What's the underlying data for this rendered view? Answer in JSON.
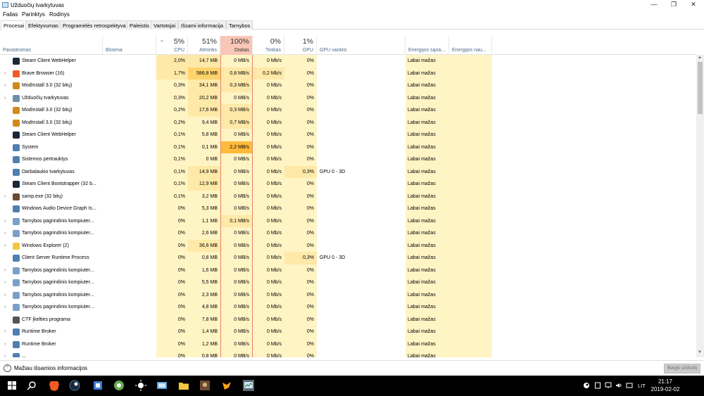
{
  "window": {
    "title": "Užduočių tvarkytuvas",
    "minimize": "—",
    "maximize": "❐",
    "close": "✕"
  },
  "menu": [
    "Failas",
    "Parinktys",
    "Rodinys"
  ],
  "tabs": [
    "Procesai",
    "Efektyvumas",
    "Programėlės retrospektyva",
    "Paleistis",
    "Vartotojai",
    "Išsami informacija",
    "Tarnybos"
  ],
  "active_tab": "Procesai",
  "columns": {
    "name": "Pavadinimas",
    "status": "Būsena",
    "cpu": {
      "pct": "5%",
      "label": "CPU"
    },
    "mem": {
      "pct": "51%",
      "label": "Atmintis"
    },
    "disk": {
      "pct": "100%",
      "label": "Diskas"
    },
    "net": {
      "pct": "0%",
      "label": "Tinklas"
    },
    "gpu": {
      "pct": "1%",
      "label": "GPU"
    },
    "gpu_engine": "GPU variklis",
    "power": "Energijos sąna...",
    "power_trend": "Energijos nau..."
  },
  "sort_icon": "chevron-down-icon",
  "rows": [
    {
      "name": "Steam Client WebHelper",
      "icon": "steam-icon",
      "expand": false,
      "cpu": "2,0%",
      "mem": "14,7 MB",
      "disk": "0 MB/s",
      "net": "0 Mb/s",
      "gpu": "0%",
      "engine": "",
      "power": "Labai mažas"
    },
    {
      "name": "Brave Browser (16)",
      "icon": "brave-icon",
      "expand": true,
      "cpu": "1,7%",
      "mem": "586,8 MB",
      "disk": "0,8 MB/s",
      "net": "0,2 Mb/s",
      "gpu": "0%",
      "engine": "",
      "power": "Labai mažas"
    },
    {
      "name": "ModInstall 3.0 (32 bitų)",
      "icon": "modinstall-icon",
      "expand": true,
      "cpu": "0,3%",
      "mem": "34,1 MB",
      "disk": "0,3 MB/s",
      "net": "0 Mb/s",
      "gpu": "0%",
      "engine": "",
      "power": "Labai mažas"
    },
    {
      "name": "Užduočių tvarkytuvas",
      "icon": "task-manager-icon",
      "expand": true,
      "cpu": "0,3%",
      "mem": "20,2 MB",
      "disk": "0 MB/s",
      "net": "0 Mb/s",
      "gpu": "0%",
      "engine": "",
      "power": "Labai mažas"
    },
    {
      "name": "ModInstall 3.0 (32 bitų)",
      "icon": "modinstall-icon",
      "expand": false,
      "cpu": "0,2%",
      "mem": "17,6 MB",
      "disk": "0,3 MB/s",
      "net": "0 Mb/s",
      "gpu": "0%",
      "engine": "",
      "power": "Labai mažas"
    },
    {
      "name": "ModInstall 3.0 (32 bitų)",
      "icon": "modinstall-icon",
      "expand": false,
      "cpu": "0,2%",
      "mem": "9,4 MB",
      "disk": "0,7 MB/s",
      "net": "0 Mb/s",
      "gpu": "0%",
      "engine": "",
      "power": "Labai mažas"
    },
    {
      "name": "Steam Client WebHelper",
      "icon": "steam-icon",
      "expand": false,
      "cpu": "0,1%",
      "mem": "5,8 MB",
      "disk": "0 MB/s",
      "net": "0 Mb/s",
      "gpu": "0%",
      "engine": "",
      "power": "Labai mažas"
    },
    {
      "name": "System",
      "icon": "system-icon",
      "expand": false,
      "cpu": "0,1%",
      "mem": "0,1 MB",
      "disk": "2,2 MB/s",
      "net": "0 Mb/s",
      "gpu": "0%",
      "engine": "",
      "power": "Labai mažas"
    },
    {
      "name": "Sistemos pertrauktys",
      "icon": "system-icon",
      "expand": false,
      "cpu": "0,1%",
      "mem": "0 MB",
      "disk": "0 MB/s",
      "net": "0 Mb/s",
      "gpu": "0%",
      "engine": "",
      "power": "Labai mažas"
    },
    {
      "name": "Darbalaukio tvarkytuvas",
      "icon": "system-icon",
      "expand": false,
      "cpu": "0,1%",
      "mem": "14,9 MB",
      "disk": "0 MB/s",
      "net": "0 Mb/s",
      "gpu": "0,3%",
      "engine": "GPU 0 - 3D",
      "power": "Labai mažas"
    },
    {
      "name": "Steam Client Bootstrapper (32 b...",
      "icon": "steam-icon",
      "expand": false,
      "cpu": "0,1%",
      "mem": "12,9 MB",
      "disk": "0 MB/s",
      "net": "0 Mb/s",
      "gpu": "0%",
      "engine": "",
      "power": "Labai mažas"
    },
    {
      "name": "samp.exe (32 bitų)",
      "icon": "samp-icon",
      "expand": true,
      "cpu": "0,1%",
      "mem": "3,2 MB",
      "disk": "0 MB/s",
      "net": "0 Mb/s",
      "gpu": "0%",
      "engine": "",
      "power": "Labai mažas"
    },
    {
      "name": "Windows Audio Device Graph Is...",
      "icon": "system-icon",
      "expand": false,
      "cpu": "0%",
      "mem": "5,3 MB",
      "disk": "0 MB/s",
      "net": "0 Mb/s",
      "gpu": "0%",
      "engine": "",
      "power": "Labai mažas"
    },
    {
      "name": "Tarnybos pagrindinis kompiuter...",
      "icon": "service-icon",
      "expand": true,
      "cpu": "0%",
      "mem": "1,1 MB",
      "disk": "0,1 MB/s",
      "net": "0 Mb/s",
      "gpu": "0%",
      "engine": "",
      "power": "Labai mažas"
    },
    {
      "name": "Tarnybos pagrindinis kompiuter...",
      "icon": "service-icon",
      "expand": true,
      "cpu": "0%",
      "mem": "2,6 MB",
      "disk": "0 MB/s",
      "net": "0 Mb/s",
      "gpu": "0%",
      "engine": "",
      "power": "Labai mažas"
    },
    {
      "name": "Windows Explorer (2)",
      "icon": "explorer-icon",
      "expand": true,
      "cpu": "0%",
      "mem": "36,6 MB",
      "disk": "0 MB/s",
      "net": "0 Mb/s",
      "gpu": "0%",
      "engine": "",
      "power": "Labai mažas"
    },
    {
      "name": "Client Server Runtime Process",
      "icon": "system-icon",
      "expand": false,
      "cpu": "0%",
      "mem": "0,8 MB",
      "disk": "0 MB/s",
      "net": "0 Mb/s",
      "gpu": "0,3%",
      "engine": "GPU 0 - 3D",
      "power": "Labai mažas"
    },
    {
      "name": "Tarnybos pagrindinis kompiuter...",
      "icon": "service-icon",
      "expand": true,
      "cpu": "0%",
      "mem": "1,6 MB",
      "disk": "0 MB/s",
      "net": "0 Mb/s",
      "gpu": "0%",
      "engine": "",
      "power": "Labai mažas"
    },
    {
      "name": "Tarnybos pagrindinis kompiuter...",
      "icon": "service-icon",
      "expand": true,
      "cpu": "0%",
      "mem": "5,5 MB",
      "disk": "0 MB/s",
      "net": "0 Mb/s",
      "gpu": "0%",
      "engine": "",
      "power": "Labai mažas"
    },
    {
      "name": "Tarnybos pagrindinis kompiuter...",
      "icon": "service-icon",
      "expand": true,
      "cpu": "0%",
      "mem": "2,3 MB",
      "disk": "0 MB/s",
      "net": "0 Mb/s",
      "gpu": "0%",
      "engine": "",
      "power": "Labai mažas"
    },
    {
      "name": "Tarnybos pagrindinis kompiuter...",
      "icon": "service-icon",
      "expand": true,
      "cpu": "0%",
      "mem": "4,8 MB",
      "disk": "0 MB/s",
      "net": "0 Mb/s",
      "gpu": "0%",
      "engine": "",
      "power": "Labai mažas"
    },
    {
      "name": "CTF įkelties programa",
      "icon": "ctf-icon",
      "expand": false,
      "cpu": "0%",
      "mem": "7,8 MB",
      "disk": "0 MB/s",
      "net": "0 Mb/s",
      "gpu": "0%",
      "engine": "",
      "power": "Labai mažas"
    },
    {
      "name": "Runtime Broker",
      "icon": "system-icon",
      "expand": true,
      "cpu": "0%",
      "mem": "1,4 MB",
      "disk": "0 MB/s",
      "net": "0 Mb/s",
      "gpu": "0%",
      "engine": "",
      "power": "Labai mažas"
    },
    {
      "name": "Runtime Broker",
      "icon": "system-icon",
      "expand": true,
      "cpu": "0%",
      "mem": "1,2 MB",
      "disk": "0 MB/s",
      "net": "0 Mb/s",
      "gpu": "0%",
      "engine": "",
      "power": "Labai mažas"
    },
    {
      "name": "...",
      "icon": "system-icon",
      "expand": true,
      "cpu": "0%",
      "mem": "0,8 MB",
      "disk": "0 MB/s",
      "net": "0 Mb/s",
      "gpu": "0%",
      "engine": "",
      "power": "Labai mažas"
    }
  ],
  "footer": {
    "fewer_details": "Mažiau išsamios informacijos",
    "end_task": "Baigti užduotį"
  },
  "taskbar": {
    "apps": [
      "windows-start-icon",
      "search-icon",
      "brave-icon",
      "steam-icon",
      "game-icon",
      "modinstall-icon",
      "sun-icon",
      "screen-icon",
      "folder-icon",
      "samp-icon",
      "gta-icon",
      "task-manager-icon"
    ],
    "tray": [
      "steam-tray-icon",
      "tablet-icon",
      "network-icon",
      "volume-icon",
      "notification-icon"
    ],
    "language": "LIT",
    "time": "21:17",
    "date": "2019-02-02"
  },
  "colors": {
    "heat_low": "#fff4c4",
    "heat_mid": "#ffe9a8",
    "heat_high": "#ffd36b",
    "heat_hot": "#ffba3a",
    "disk_header": "#f9c6b8",
    "disk_border": "#e8826a"
  }
}
